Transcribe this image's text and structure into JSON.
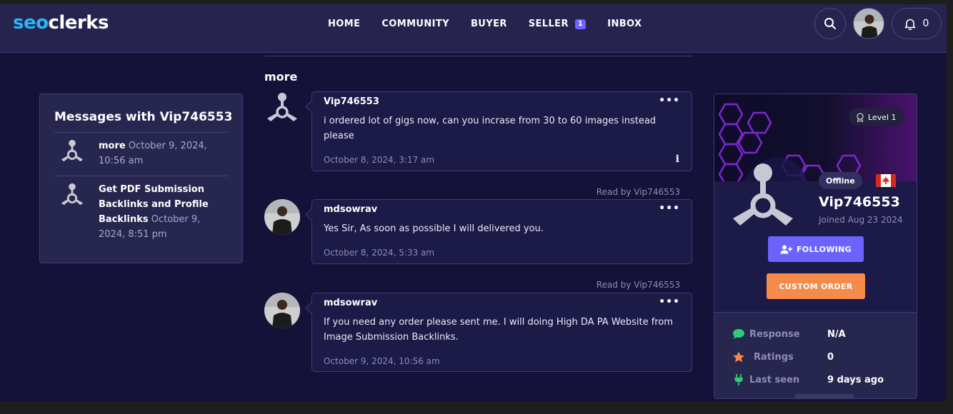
{
  "brand": {
    "logo_seo": "seo",
    "logo_clerks": "clerks"
  },
  "nav": {
    "home": "HOME",
    "community": "COMMUNITY",
    "buyer": "BUYER",
    "seller": "SELLER",
    "seller_badge": "1",
    "inbox": "INBOX"
  },
  "header": {
    "notifications_count": "0"
  },
  "sidebar": {
    "title": "Messages with Vip746553",
    "conversations": [
      {
        "subject": "more",
        "date": "October 9, 2024, 10:56 am"
      },
      {
        "subject": "Get PDF Submission Backlinks and Profile Backlinks",
        "date": "October 9, 2024, 8:51 pm"
      }
    ]
  },
  "thread": {
    "title": "more",
    "messages": [
      {
        "author": "Vip746553",
        "body": "i ordered lot of gigs now, can you incrase from 30 to 60 images instead please",
        "time": "October 8, 2024, 3:17 am",
        "read_by": ""
      },
      {
        "author": "mdsowrav",
        "body": "Yes Sir, As soon as possible I will delivered you.",
        "time": "October 8, 2024, 5:33 am",
        "read_by": "Read by Vip746553"
      },
      {
        "author": "mdsowrav",
        "body": "If you need any order please sent me. I will doing High DA PA Website from Image Submission Backlinks.",
        "time": "October 9, 2024, 10:56 am",
        "read_by": "Read by Vip746553"
      }
    ],
    "menu_glyph": "•••",
    "info_glyph": "i"
  },
  "profile": {
    "level": "Level 1",
    "status": "Offline",
    "name": "Vip746553",
    "joined": "Joined Aug 23 2024",
    "follow_label": "FOLLOWING",
    "custom_order_label": "CUSTOM ORDER",
    "stats": [
      {
        "label": "Response",
        "value": "N/A",
        "icon": "chat-bubble-icon"
      },
      {
        "label": "Ratings",
        "value": "0",
        "icon": "star-icon"
      },
      {
        "label": "Last seen",
        "value": "9 days ago",
        "icon": "plug-icon"
      }
    ]
  },
  "colors": {
    "background": "#15123a",
    "header": "#26244f",
    "accent_purple": "#6c63ff",
    "accent_orange": "#f58a4b",
    "logo_blue": "#29b6f6"
  }
}
